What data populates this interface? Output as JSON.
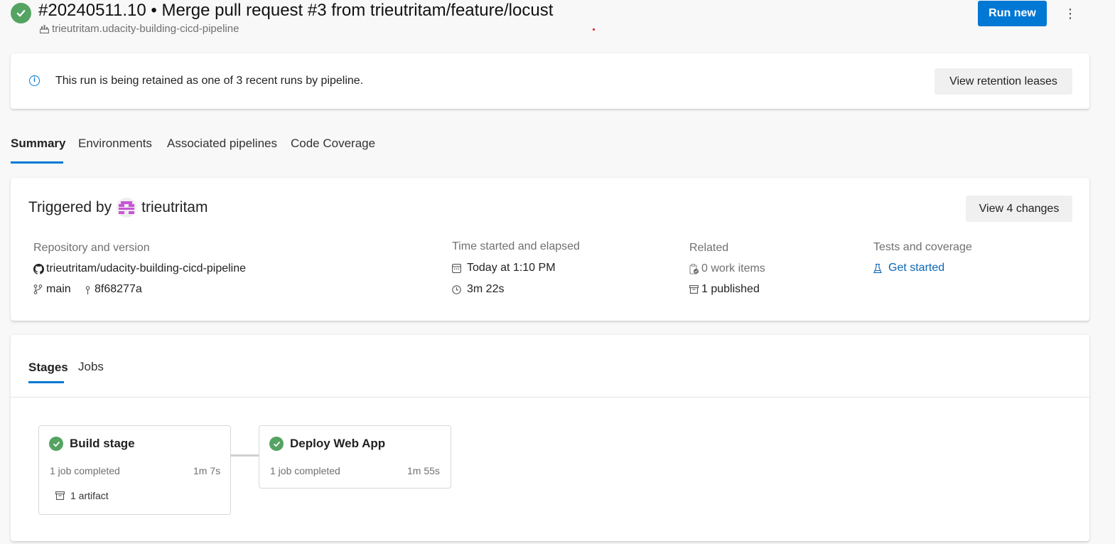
{
  "header": {
    "status": "succeeded",
    "title": "#20240511.10 • Merge pull request #3 from trieutritam/feature/locust",
    "pipeline_name": "trieutritam.udacity-building-cicd-pipeline",
    "run_new_label": "Run new",
    "more_label": "⋮"
  },
  "banner": {
    "icon": "info-icon",
    "icon_glyph": "i",
    "text": "This run is being retained as one of 3 recent runs by pipeline.",
    "button_label": "View retention leases"
  },
  "tabs": [
    {
      "label": "Summary",
      "active": true
    },
    {
      "label": "Environments",
      "active": false
    },
    {
      "label": "Associated pipelines",
      "active": false
    },
    {
      "label": "Code Coverage",
      "active": false
    }
  ],
  "summary": {
    "triggered_by_label": "Triggered by",
    "triggered_by_user": "trieutritam",
    "view_changes_label": "View 4 changes",
    "repository": {
      "label": "Repository and version",
      "repo": "trieutritam/udacity-building-cicd-pipeline",
      "branch": "main",
      "commit": "8f68277a"
    },
    "time": {
      "label": "Time started and elapsed",
      "started": "Today at 1:10 PM",
      "elapsed": "3m 22s"
    },
    "related": {
      "label": "Related",
      "work_items": "0 work items",
      "published": "1 published"
    },
    "tests": {
      "label": "Tests and coverage",
      "link": "Get started"
    }
  },
  "stages_section": {
    "tabs": [
      {
        "label": "Stages",
        "active": true
      },
      {
        "label": "Jobs",
        "active": false
      }
    ],
    "stages": [
      {
        "name": "Build stage",
        "status": "succeeded",
        "jobs": "1 job completed",
        "duration": "1m 7s",
        "artifacts": "1 artifact"
      },
      {
        "name": "Deploy Web App",
        "status": "succeeded",
        "jobs": "1 job completed",
        "duration": "1m 55s"
      }
    ]
  },
  "colors": {
    "accent": "#0078d4",
    "success": "#55a362",
    "link": "#0c66b5",
    "avatar": "#c756d8"
  }
}
